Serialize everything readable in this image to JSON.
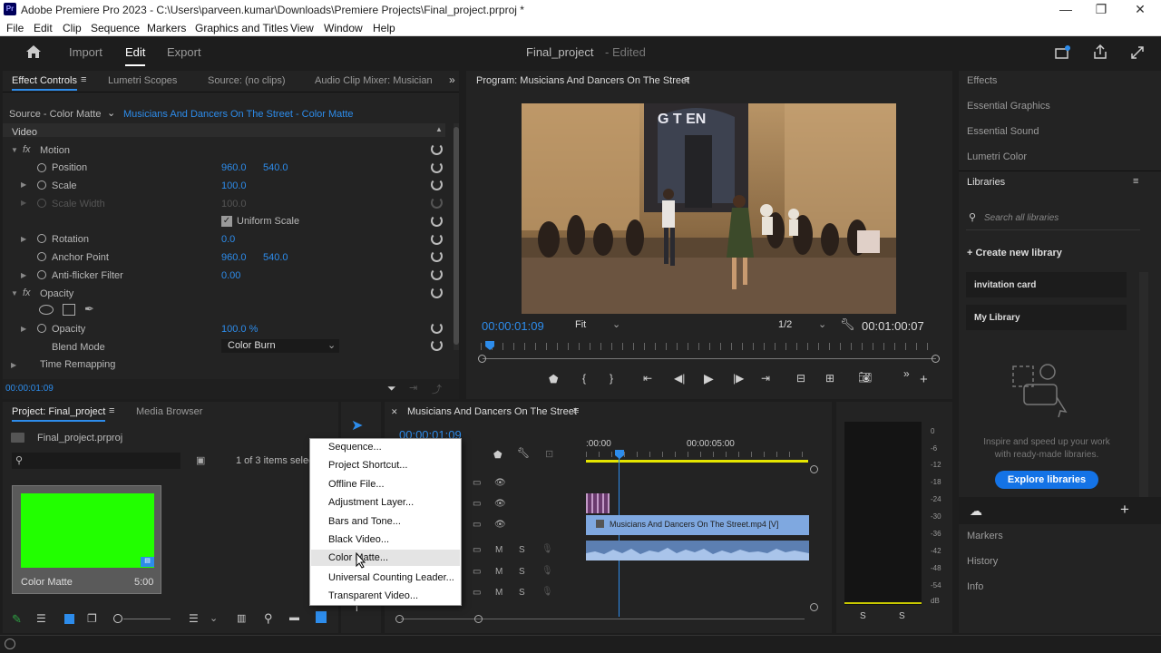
{
  "titlebar": {
    "title": "Adobe Premiere Pro 2023 - C:\\Users\\parveen.kumar\\Downloads\\Premiere Projects\\Final_project.prproj *",
    "logo": "Pr"
  },
  "menu": [
    "File",
    "Edit",
    "Clip",
    "Sequence",
    "Markers",
    "Graphics and Titles",
    "View",
    "Window",
    "Help"
  ],
  "header": {
    "home_icon": "home-icon",
    "tabs": {
      "import": "Import",
      "edit": "Edit",
      "export": "Export"
    },
    "project_name": "Final_project",
    "status": "- Edited"
  },
  "effect_controls": {
    "tabs": {
      "effect_controls": "Effect Controls",
      "lumetri": "Lumetri Scopes",
      "source": "Source: (no clips)",
      "audio_mixer": "Audio Clip Mixer: Musician"
    },
    "source_label": "Source - Color Matte",
    "clip_label": "Musicians And Dancers On The Street - Color Matte",
    "video_label": "Video",
    "motion": "Motion",
    "position": {
      "label": "Position",
      "x": "960.0",
      "y": "540.0"
    },
    "scale": {
      "label": "Scale",
      "value": "100.0"
    },
    "scale_width": {
      "label": "Scale Width",
      "value": "100.0"
    },
    "uniform_scale": "Uniform Scale",
    "rotation": {
      "label": "Rotation",
      "value": "0.0"
    },
    "anchor": {
      "label": "Anchor Point",
      "x": "960.0",
      "y": "540.0"
    },
    "antiflicker": {
      "label": "Anti-flicker Filter",
      "value": "0.00"
    },
    "opacity_group": "Opacity",
    "opacity": {
      "label": "Opacity",
      "value": "100.0 %"
    },
    "blend": {
      "label": "Blend Mode",
      "value": "Color Burn"
    },
    "time_remap": "Time Remapping",
    "timecode": "00:00:01:09"
  },
  "program": {
    "title": "Program: Musicians And Dancers On The Street",
    "timecode": "00:00:01:09",
    "fit": "Fit",
    "res": "1/2",
    "duration": "00:01:00:07",
    "playhead_fraction": 0.02
  },
  "right_panel": {
    "items": [
      "Effects",
      "Essential Graphics",
      "Essential Sound",
      "Lumetri Color"
    ],
    "libraries": "Libraries",
    "search_placeholder": "Search all libraries",
    "create": "Create new library",
    "libs": [
      "invitation card",
      "My Library"
    ],
    "promo": "Inspire and speed up your work with ready-made libraries.",
    "explore": "Explore libraries",
    "bottom": [
      "Markers",
      "History",
      "Info"
    ]
  },
  "project": {
    "tabs": {
      "project": "Project: Final_project",
      "media_browser": "Media Browser"
    },
    "file": "Final_project.prproj",
    "count": "1 of 3 items selec",
    "clip": {
      "name": "Color Matte",
      "duration": "5:00",
      "color": "#22ff00"
    }
  },
  "context_menu": [
    "Sequence...",
    "Project Shortcut...",
    "Offline File...",
    "Adjustment Layer...",
    "Bars and Tone...",
    "Black Video...",
    "Color Matte...",
    "Universal Counting Leader...",
    "Transparent Video..."
  ],
  "timeline": {
    "title": "Musicians And Dancers On The Street",
    "timecode": "00:00:01:09",
    "ruler": [
      ":00:00",
      "00:00:05:00"
    ],
    "clip": "Musicians And Dancers On The Street.mp4 [V]",
    "track_labels": {
      "m": "M",
      "s": "S"
    }
  },
  "meters": {
    "scale": [
      "0",
      "-6",
      "-12",
      "-18",
      "-24",
      "-30",
      "-36",
      "-42",
      "-48",
      "-54",
      "dB"
    ],
    "solo": [
      "S",
      "S"
    ]
  },
  "colors": {
    "accent": "#2d8ceb",
    "clip": "#7fa8e0",
    "green": "#22ff00"
  }
}
